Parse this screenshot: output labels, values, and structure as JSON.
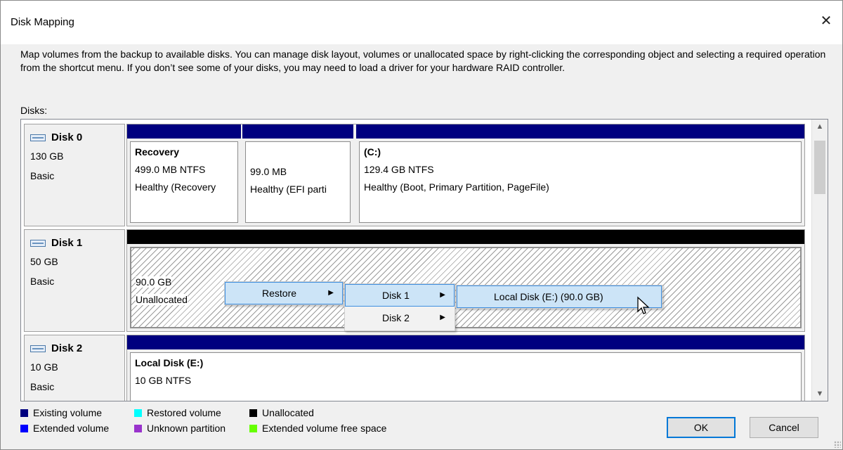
{
  "window": {
    "title": "Disk Mapping",
    "close_glyph": "✕"
  },
  "description": "Map volumes from the backup to available disks. You can manage disk layout, volumes or unallocated space by right-clicking the corresponding object and selecting a required operation from the shortcut menu. If you don’t see some of your disks, you may need to load a driver for your hardware RAID controller.",
  "disks_label": "Disks:",
  "colors": {
    "existing_volume": "#00007f",
    "restored_volume": "#00ffff",
    "unallocated": "#000000",
    "extended_volume": "#0000ff",
    "unknown_partition": "#9933cc",
    "extended_free_space": "#66ff00",
    "selection": "#cce4f7",
    "selection_border": "#3d8ee0"
  },
  "disks": [
    {
      "name": "Disk 0",
      "size": "130 GB",
      "type": "Basic",
      "partitions": [
        {
          "name": "Recovery",
          "size": "499.0 MB NTFS",
          "status": "Healthy (Recovery"
        },
        {
          "name": "",
          "size": "99.0 MB",
          "status": "Healthy (EFI parti"
        },
        {
          "name": "(C:)",
          "size": "129.4 GB NTFS",
          "status": "Healthy (Boot, Primary Partition, PageFile)"
        }
      ]
    },
    {
      "name": "Disk 1",
      "size": "50 GB",
      "type": "Basic",
      "partitions": [
        {
          "size": "90.0 GB",
          "status": "Unallocated"
        }
      ]
    },
    {
      "name": "Disk 2",
      "size": "10 GB",
      "type": "Basic",
      "partitions": [
        {
          "name": "Local Disk (E:)",
          "size": "10 GB NTFS"
        }
      ]
    }
  ],
  "context_menu": {
    "level1": [
      {
        "label": "Restore",
        "arrow": "▶"
      }
    ],
    "level2": [
      {
        "label": "Disk 1",
        "arrow": "▶"
      },
      {
        "label": "Disk 2",
        "arrow": "▶"
      }
    ],
    "level3": [
      {
        "label": "Local Disk (E:) (90.0 GB)"
      }
    ]
  },
  "legend": [
    {
      "label": "Existing volume"
    },
    {
      "label": "Restored volume"
    },
    {
      "label": "Unallocated"
    },
    {
      "label": "Extended volume"
    },
    {
      "label": "Unknown partition"
    },
    {
      "label": "Extended volume free space"
    }
  ],
  "buttons": {
    "ok": "OK",
    "cancel": "Cancel"
  },
  "scroll": {
    "up_glyph": "▲",
    "down_glyph": "▼"
  }
}
